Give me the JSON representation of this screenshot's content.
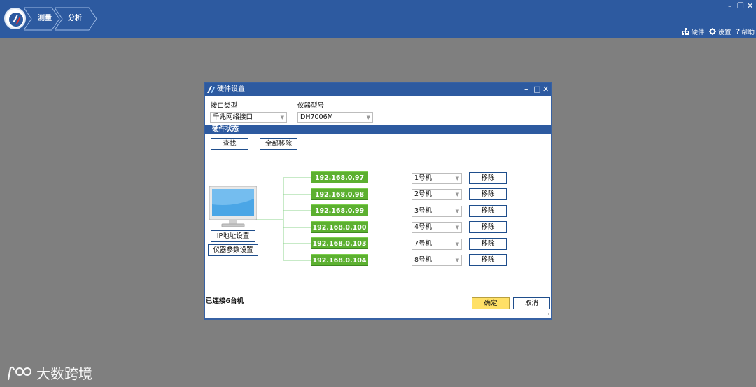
{
  "app": {
    "tabs": [
      {
        "label": "测量"
      },
      {
        "label": "分析"
      }
    ],
    "window_controls": {
      "minimize": "–",
      "restore": "❐",
      "close": "✕"
    },
    "links": [
      {
        "label": "硬件",
        "icon": "network-icon"
      },
      {
        "label": "设置",
        "icon": "gear-icon"
      },
      {
        "label": "帮助",
        "icon": "help-icon"
      }
    ]
  },
  "dialog": {
    "title": "硬件设置",
    "interface_label": "接口类型",
    "interface_value": "千兆网络接口",
    "model_label": "仪器型号",
    "model_value": "DH7006M",
    "section_title": "硬件状态",
    "find_button": "查找",
    "remove_all_button": "全部移除",
    "ip_settings_button": "IP地址设置",
    "param_settings_button": "仪器参数设置",
    "devices": [
      {
        "ip": "192.168.0.97",
        "unit": "1号机",
        "remove": "移除"
      },
      {
        "ip": "192.168.0.98",
        "unit": "2号机",
        "remove": "移除"
      },
      {
        "ip": "192.168.0.99",
        "unit": "3号机",
        "remove": "移除"
      },
      {
        "ip": "192.168.0.100",
        "unit": "4号机",
        "remove": "移除"
      },
      {
        "ip": "192.168.0.103",
        "unit": "7号机",
        "remove": "移除"
      },
      {
        "ip": "192.168.0.104",
        "unit": "8号机",
        "remove": "移除"
      }
    ],
    "status_text": "已连接6台机",
    "ok_button": "确定",
    "cancel_button": "取消"
  },
  "watermark": {
    "text": "大数跨境"
  },
  "colors": {
    "titlebar": "#2d5aa0",
    "ip_badge": "#5cb030",
    "confirm": "#ffe066",
    "desktop": "#7f7f7f"
  }
}
